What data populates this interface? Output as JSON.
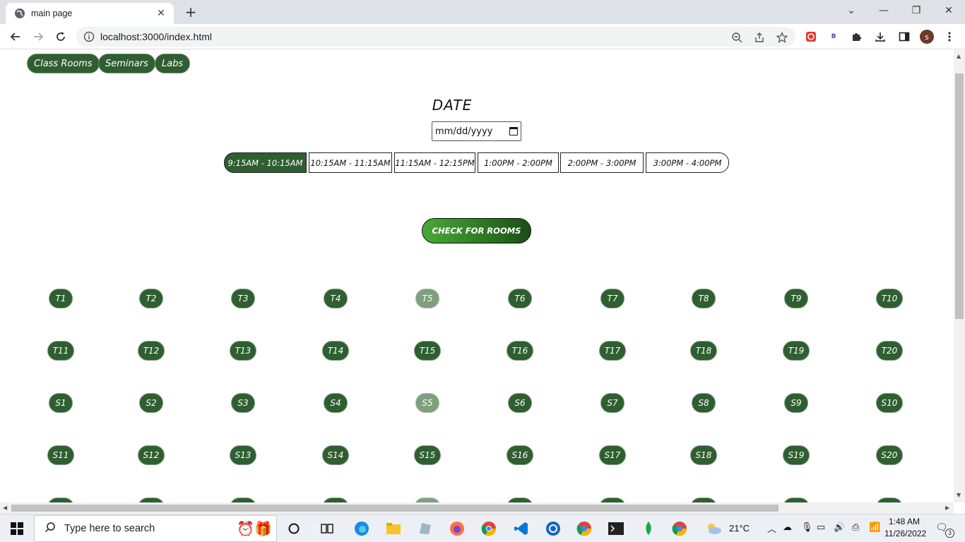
{
  "browser": {
    "tab_title": "main page",
    "url": "localhost:3000/index.html",
    "profile_initial": "s"
  },
  "page": {
    "nav": [
      "Class Rooms",
      "Seminars",
      "Labs"
    ],
    "date_title": "DATE",
    "date_placeholder": "mm/dd/yyyy",
    "time_slots": [
      {
        "label": "9:15AM - 10:15AM",
        "selected": true
      },
      {
        "label": "10:15AM - 11:15AM",
        "selected": false
      },
      {
        "label": "11:15AM - 12:15PM",
        "selected": false
      },
      {
        "label": "1:00PM - 2:00PM",
        "selected": false
      },
      {
        "label": "2:00PM - 3:00PM",
        "selected": false
      },
      {
        "label": "3:00PM - 4:00PM",
        "selected": false
      }
    ],
    "check_button": "CHECK FOR ROOMS",
    "rooms": [
      [
        "T1",
        "T2",
        "T3",
        "T4",
        "T5",
        "T6",
        "T7",
        "T8",
        "T9",
        "T10"
      ],
      [
        "T11",
        "T12",
        "T13",
        "T14",
        "T15",
        "T16",
        "T17",
        "T18",
        "T19",
        "T20"
      ],
      [
        "S1",
        "S2",
        "S3",
        "S4",
        "S5",
        "S6",
        "S7",
        "S8",
        "S9",
        "S10"
      ],
      [
        "S11",
        "S12",
        "S13",
        "S14",
        "S15",
        "S16",
        "S17",
        "S18",
        "S19",
        "S20"
      ]
    ],
    "unavailable_rooms": [
      "T5",
      "S5"
    ]
  },
  "taskbar": {
    "search_placeholder": "Type here to search",
    "weather": "21°C",
    "time": "1:48 AM",
    "date": "11/26/2022",
    "notification_count": "3"
  },
  "colors": {
    "accent_green": "#2f5e31",
    "disabled_green": "#7fa07f"
  }
}
